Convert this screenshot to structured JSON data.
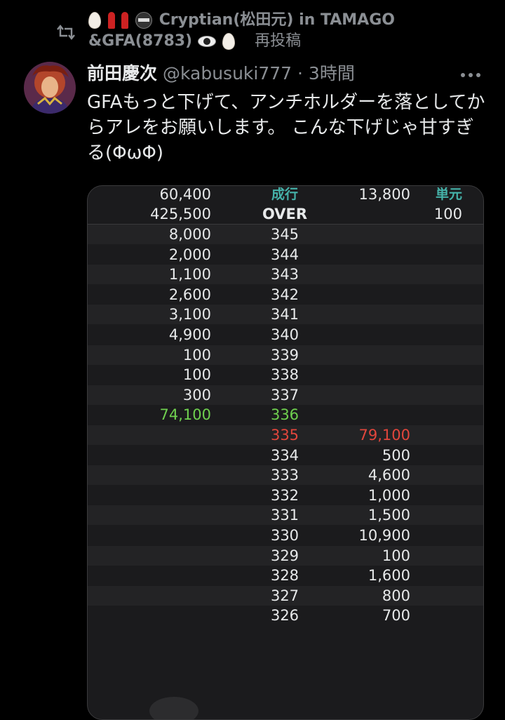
{
  "retweet": {
    "line1": "Cryptian(松田元) in TAMAGO",
    "line2": "&GFA(8783)",
    "tag": "再投稿"
  },
  "tweet": {
    "display_name": "前田慶次",
    "handle": "@kabusuki777",
    "separator": "·",
    "time": "3時間",
    "text": "GFAもっと下げて、アンチホルダーを落としてからアレをお願いします。 こんな下げじゃ甘すぎる(ΦωΦ)"
  },
  "board": {
    "header": {
      "row1": {
        "left": "60,400",
        "center": "成行",
        "ask": "13,800",
        "unit": "単元"
      },
      "row2": {
        "left": "425,500",
        "center": "OVER",
        "ask": "",
        "unit": "100"
      }
    },
    "rows": [
      {
        "bid_qty": "8,000",
        "price": "345",
        "ask_qty": ""
      },
      {
        "bid_qty": "2,000",
        "price": "344",
        "ask_qty": ""
      },
      {
        "bid_qty": "1,100",
        "price": "343",
        "ask_qty": ""
      },
      {
        "bid_qty": "2,600",
        "price": "342",
        "ask_qty": ""
      },
      {
        "bid_qty": "3,100",
        "price": "341",
        "ask_qty": ""
      },
      {
        "bid_qty": "4,900",
        "price": "340",
        "ask_qty": ""
      },
      {
        "bid_qty": "100",
        "price": "339",
        "ask_qty": ""
      },
      {
        "bid_qty": "100",
        "price": "338",
        "ask_qty": ""
      },
      {
        "bid_qty": "300",
        "price": "337",
        "ask_qty": ""
      },
      {
        "bid_qty": "74,100",
        "price": "336",
        "ask_qty": "",
        "color": "#6fd04f"
      },
      {
        "bid_qty": "",
        "price": "335",
        "ask_qty": "79,100",
        "color": "#e2463c"
      },
      {
        "bid_qty": "",
        "price": "334",
        "ask_qty": "500"
      },
      {
        "bid_qty": "",
        "price": "333",
        "ask_qty": "4,600"
      },
      {
        "bid_qty": "",
        "price": "332",
        "ask_qty": "1,000"
      },
      {
        "bid_qty": "",
        "price": "331",
        "ask_qty": "1,500"
      },
      {
        "bid_qty": "",
        "price": "330",
        "ask_qty": "10,900"
      },
      {
        "bid_qty": "",
        "price": "329",
        "ask_qty": "100"
      },
      {
        "bid_qty": "",
        "price": "328",
        "ask_qty": "1,600"
      },
      {
        "bid_qty": "",
        "price": "327",
        "ask_qty": "800"
      },
      {
        "bid_qty": "",
        "price": "326",
        "ask_qty": "700"
      }
    ]
  },
  "colors": {
    "background": "#000000",
    "text_primary": "#e7e9ea",
    "text_secondary": "#8b8f94",
    "header_accent": "#45b2a9",
    "bid_highlight": "#6fd04f",
    "ask_highlight": "#e2463c"
  },
  "icons": [
    "retweet-icon",
    "more-icon",
    "egg-emoji",
    "eye-emoji"
  ]
}
